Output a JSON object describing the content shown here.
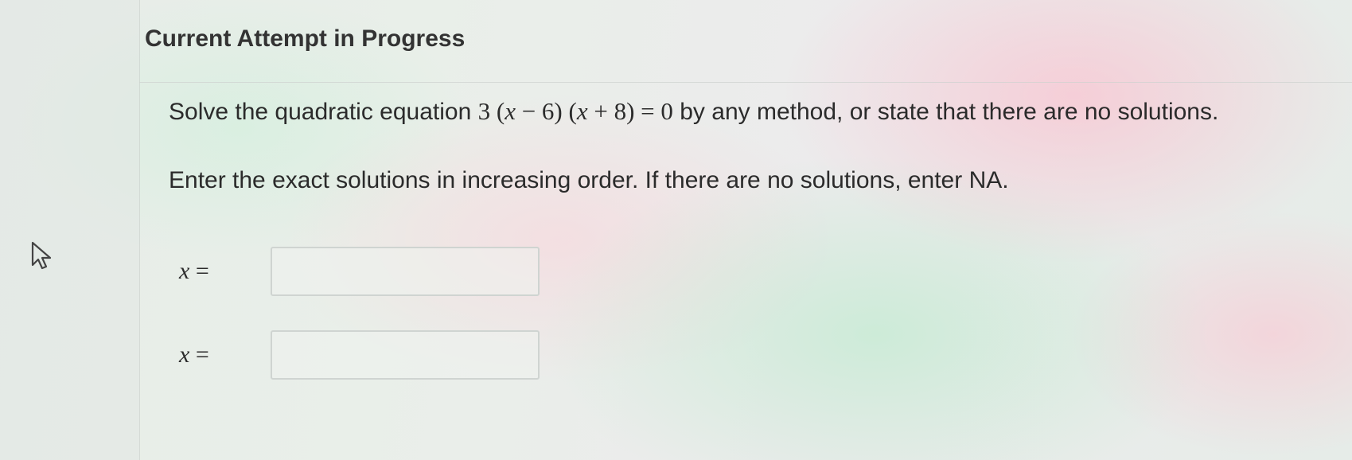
{
  "header": {
    "title": "Current Attempt in Progress"
  },
  "question": {
    "prefix": "Solve the quadratic equation ",
    "equation": {
      "coef": "3",
      "f1_var": "x",
      "f1_rest": " − 6)",
      "f2_var": "x",
      "f2_rest": " + 8) = 0"
    },
    "suffix": " by any method, or state that there are no solutions.",
    "instructions": "Enter the exact solutions in increasing order. If there are no solutions, enter NA."
  },
  "answers": [
    {
      "variable": "x",
      "equals": " =",
      "value": ""
    },
    {
      "variable": "x",
      "equals": " =",
      "value": ""
    }
  ],
  "icons": {
    "pointer": "mouse-pointer-icon"
  },
  "colors": {
    "text": "#2b2b2b",
    "input_border": "#cfd4d1"
  }
}
